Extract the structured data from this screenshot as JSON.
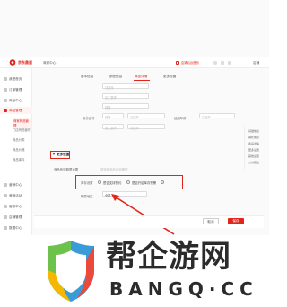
{
  "header": {
    "brand": "京东鼎道",
    "module": "商家中心",
    "right_link": "店铺后台首页",
    "right_misc": "退出",
    "user": "店铺"
  },
  "sidebar": {
    "items": [
      {
        "label": "我是首页"
      },
      {
        "label": "订单管理"
      },
      {
        "label": "商品中心"
      },
      {
        "label": "商品管理"
      },
      {
        "label": "营销中心"
      },
      {
        "label": "营销活动"
      },
      {
        "label": "客服中心"
      },
      {
        "label": "店铺管理"
      },
      {
        "label": "数据中心"
      }
    ],
    "subitems": [
      {
        "label": "商家商品管理"
      },
      {
        "label": "门店商品管理"
      },
      {
        "label": "商品分类"
      },
      {
        "label": "商品价格"
      },
      {
        "label": "商品库存"
      }
    ]
  },
  "tabs": [
    {
      "label": "基本信息"
    },
    {
      "label": "销售信息"
    },
    {
      "label": "商品详情"
    },
    {
      "label": "更多设置"
    }
  ],
  "form": {
    "placeholder": "请选择",
    "field1": "加工要求",
    "field2": "规格",
    "left_label": "身份证号",
    "select_a": "请选择",
    "mid_label": "规格",
    "select_b": "请选择",
    "right_label": "适用年龄",
    "select_c": "请选择",
    "sub_label": "加工要求",
    "more_settings": "更多设置",
    "more_row_label": "商品有效期限设置",
    "more_row_hint": "请选择商品有效期限",
    "highlight_label": "库存设置",
    "option1": "是否支持预约",
    "option2": "是否开启库存预警",
    "info_icon": "info-icon",
    "shop_label": "所属地区",
    "shop_value": "全国"
  },
  "right_panel": {
    "items": [
      {
        "label": "基础信息"
      },
      {
        "label": "销售信息"
      },
      {
        "label": "商品详情"
      },
      {
        "label": "更多设置"
      },
      {
        "label": "其他设置"
      },
      {
        "label": "公共属性"
      }
    ]
  },
  "footer": {
    "cancel": "取消",
    "submit": "保存"
  },
  "watermark": {
    "title": "帮企游网",
    "subtitle": "BANGQ·CC"
  },
  "colors": {
    "accent": "#e1251b",
    "logo_green": "#6cc24a",
    "logo_yellow": "#f5b800",
    "logo_blue": "#3a9bd9",
    "logo_red": "#ea4a3c",
    "watermark_text": "#2b2b2b"
  }
}
